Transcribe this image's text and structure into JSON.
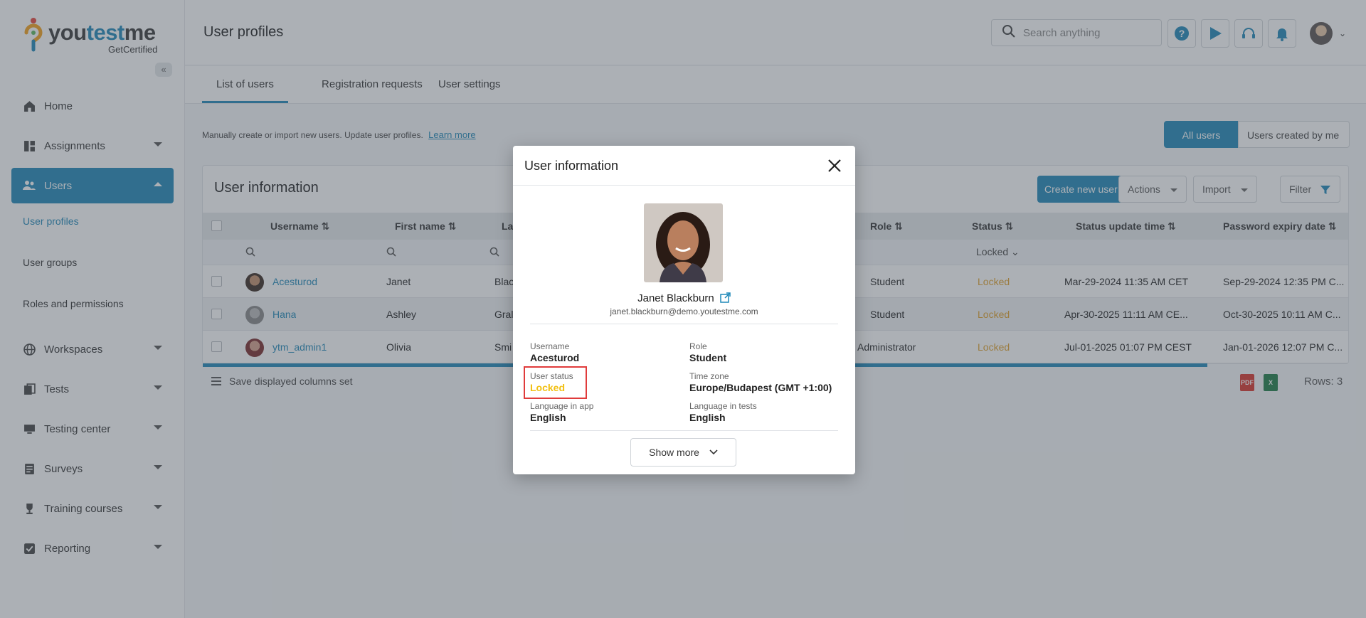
{
  "app": {
    "logo_word_a": "you",
    "logo_word_b": "test",
    "logo_word_c": "me",
    "logo_sub": "GetCertified",
    "page_title": "User profiles",
    "search_placeholder": "Search anything",
    "accent": "#1f88b8"
  },
  "sidebar": {
    "items": [
      {
        "label": "Home",
        "icon": "home-icon"
      },
      {
        "label": "Assignments",
        "icon": "dashboard-icon"
      },
      {
        "label": "Users",
        "icon": "users-icon"
      },
      {
        "label": "Workspaces",
        "icon": "globe-icon"
      },
      {
        "label": "Tests",
        "icon": "copy-icon"
      },
      {
        "label": "Testing center",
        "icon": "monitor-icon"
      },
      {
        "label": "Surveys",
        "icon": "survey-icon"
      },
      {
        "label": "Training courses",
        "icon": "trophy-icon"
      },
      {
        "label": "Reporting",
        "icon": "report-icon"
      }
    ],
    "sub": [
      "User profiles",
      "User groups",
      "Roles and permissions"
    ]
  },
  "tabs": [
    "List of users",
    "Registration requests",
    "User settings"
  ],
  "intro": {
    "text": "Manually create or import new users. Update user profiles.",
    "link": "Learn more"
  },
  "scope": {
    "all": "All users",
    "mine": "Users created by me"
  },
  "card": {
    "title": "User information",
    "create": "Create new user",
    "actions": "Actions",
    "import": "Import",
    "filter": "Filter",
    "save_cols": "Save displayed columns set",
    "rows": "Rows: 3"
  },
  "table": {
    "headers": {
      "username": "Username",
      "first": "First name",
      "last": "La",
      "role": "Role",
      "status": "Status",
      "status_time": "Status update time",
      "pwd": "Password expiry date"
    },
    "status_filter": "Locked",
    "rows": [
      {
        "username": "Acesturod",
        "first": "Janet",
        "last": "Blac",
        "role": "Student",
        "status": "Locked",
        "time": "Mar-29-2024 11:35 AM CET",
        "pwd": "Sep-29-2024 12:35 PM C..."
      },
      {
        "username": "Hana",
        "first": "Ashley",
        "last": "Gral",
        "role": "Student",
        "status": "Locked",
        "time": "Apr-30-2025 11:11 AM CE...",
        "pwd": "Oct-30-2025 10:11 AM C..."
      },
      {
        "username": "ytm_admin1",
        "first": "Olivia",
        "last": "Smi",
        "role": "Administrator",
        "status": "Locked",
        "time": "Jul-01-2025 01:07 PM CEST",
        "pwd": "Jan-01-2026 12:07 PM C..."
      }
    ]
  },
  "modal": {
    "title": "User information",
    "name": "Janet Blackburn",
    "email": "janet.blackburn@demo.youtestme.com",
    "username_label": "Username",
    "username": "Acesturod",
    "role_label": "Role",
    "role": "Student",
    "status_label": "User status",
    "status": "Locked",
    "tz_label": "Time zone",
    "tz": "Europe/Budapest (GMT +1:00)",
    "lang_app_label": "Language in app",
    "lang_app": "English",
    "lang_test_label": "Language in tests",
    "lang_test": "English",
    "show_more": "Show more"
  }
}
